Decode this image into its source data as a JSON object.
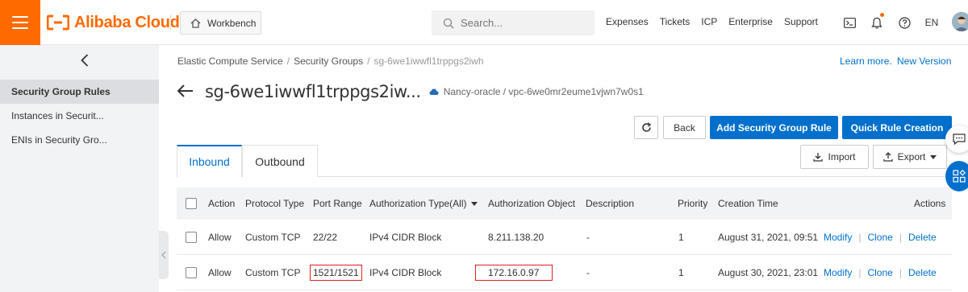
{
  "topbar": {
    "brand": "Alibaba Cloud",
    "workbench": "Workbench",
    "search_placeholder": "Search...",
    "links": [
      "Expenses",
      "Tickets",
      "ICP",
      "Enterprise",
      "Support"
    ],
    "lang": "EN"
  },
  "sidebar": {
    "items": [
      {
        "label": "Security Group Rules",
        "active": true
      },
      {
        "label": "Instances in Securit..."
      },
      {
        "label": "ENIs in Security Gro..."
      }
    ]
  },
  "breadcrumb": [
    "Elastic Compute Service",
    "Security Groups",
    "sg-6we1iwwfl1trppgs2iwh"
  ],
  "header_links": {
    "learn_more": "Learn more.",
    "new_version": "New Version"
  },
  "page": {
    "title": "sg-6we1iwwfl1trppgs2iw...",
    "subtitle": "Nancy-oracle / vpc-6we0mr2eume1vjwn7w0s1"
  },
  "actions": {
    "back": "Back",
    "add_rule": "Add Security Group Rule",
    "quick_rule": "Quick Rule Creation",
    "import": "Import",
    "export": "Export"
  },
  "tabs": [
    "Inbound",
    "Outbound"
  ],
  "table": {
    "headers": [
      "Action",
      "Protocol Type",
      "Port Range",
      "Authorization Type(All)",
      "Authorization Object",
      "Description",
      "Priority",
      "Creation Time",
      "Actions"
    ],
    "rows": [
      {
        "action": "Allow",
        "protocol": "Custom TCP",
        "port": "22/22",
        "auth_type": "IPv4 CIDR Block",
        "auth_object": "8.211.138.20",
        "description": "-",
        "priority": "1",
        "created": "August 31, 2021, 09:51",
        "ops": [
          "Modify",
          "Clone",
          "Delete"
        ]
      },
      {
        "action": "Allow",
        "protocol": "Custom TCP",
        "port": "1521/1521",
        "auth_type": "IPv4 CIDR Block",
        "auth_object": "172.16.0.97",
        "description": "-",
        "priority": "1",
        "created": "August 30, 2021, 23:01",
        "ops": [
          "Modify",
          "Clone",
          "Delete"
        ]
      }
    ]
  },
  "colors": {
    "brand_orange": "#ff6a00",
    "primary_blue": "#0070cc",
    "highlight_red": "#e02020"
  }
}
